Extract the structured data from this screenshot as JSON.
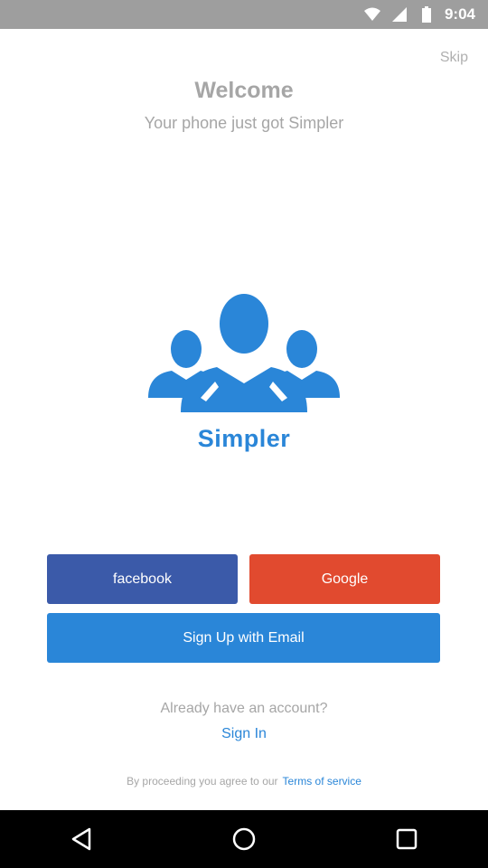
{
  "status_bar": {
    "time": "9:04",
    "icons": [
      "wifi-icon",
      "signal-icon",
      "battery-icon"
    ]
  },
  "header": {
    "skip_label": "Skip",
    "welcome_title": "Welcome",
    "tagline": "Your phone just got Simpler"
  },
  "logo": {
    "icon": "people-group-icon",
    "color": "#2a86d8",
    "brand_name": "Simpler"
  },
  "auth": {
    "facebook_label": "facebook",
    "google_label": "Google",
    "email_label": "Sign Up with Email",
    "facebook_color": "#3b5aa9",
    "google_color": "#e14a2f",
    "email_color": "#2a86d8"
  },
  "signin": {
    "prompt": "Already have an account?",
    "link_label": "Sign In"
  },
  "terms": {
    "text": "By proceeding you agree to our",
    "link_label": "Terms of service"
  },
  "nav_bar": {
    "items": [
      "back-icon",
      "home-icon",
      "recents-icon"
    ]
  }
}
